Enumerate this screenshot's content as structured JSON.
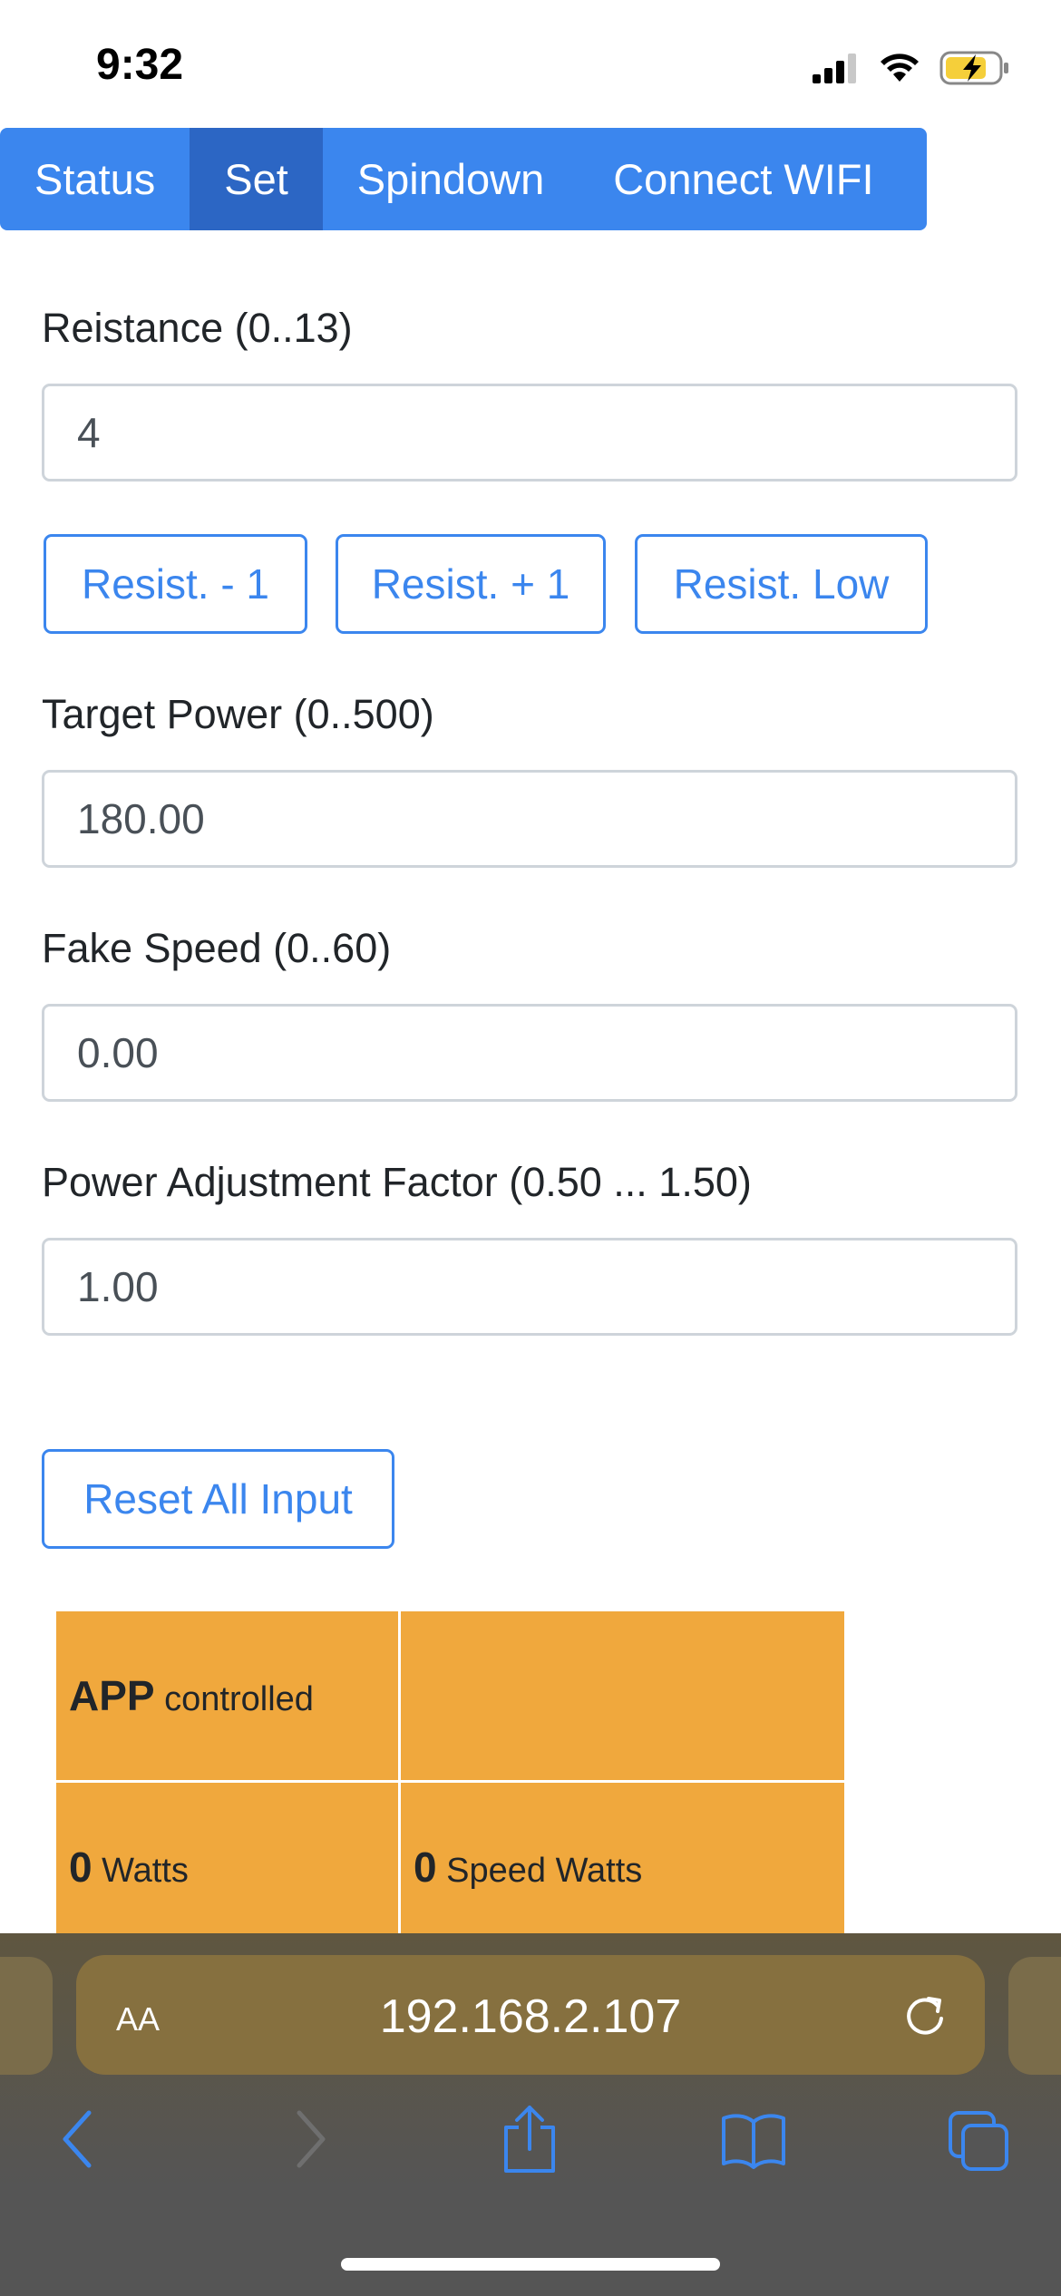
{
  "status_bar": {
    "time": "9:32"
  },
  "nav": {
    "tabs": [
      {
        "label": "Status",
        "active": false
      },
      {
        "label": "Set",
        "active": true
      },
      {
        "label": "Spindown",
        "active": false
      },
      {
        "label": "Connect WIFI",
        "active": false
      }
    ]
  },
  "form": {
    "resistance": {
      "label": "Reistance (0..13)",
      "value": "4"
    },
    "resist_buttons": {
      "minus": "Resist. - 1",
      "plus": "Resist. + 1",
      "low": "Resist. Low"
    },
    "target_power": {
      "label": "Target Power (0..500)",
      "value": "180.00"
    },
    "fake_speed": {
      "label": "Fake Speed (0..60)",
      "value": "0.00"
    },
    "power_adjustment": {
      "label": "Power Adjustment Factor (0.50 ... 1.50)",
      "value": "1.00"
    },
    "reset_label": "Reset All Input"
  },
  "status_table": {
    "mode_value": "APP",
    "mode_unit": "controlled",
    "watts_value": "0",
    "watts_unit": "Watts",
    "speed_watts_value": "0",
    "speed_watts_unit": "Speed Watts"
  },
  "browser": {
    "aa_label": "AA",
    "url": "192.168.2.107"
  },
  "colors": {
    "primary": "#3b86ee",
    "primary_active": "#2c66c4",
    "table_bg": "#f0a83d"
  }
}
